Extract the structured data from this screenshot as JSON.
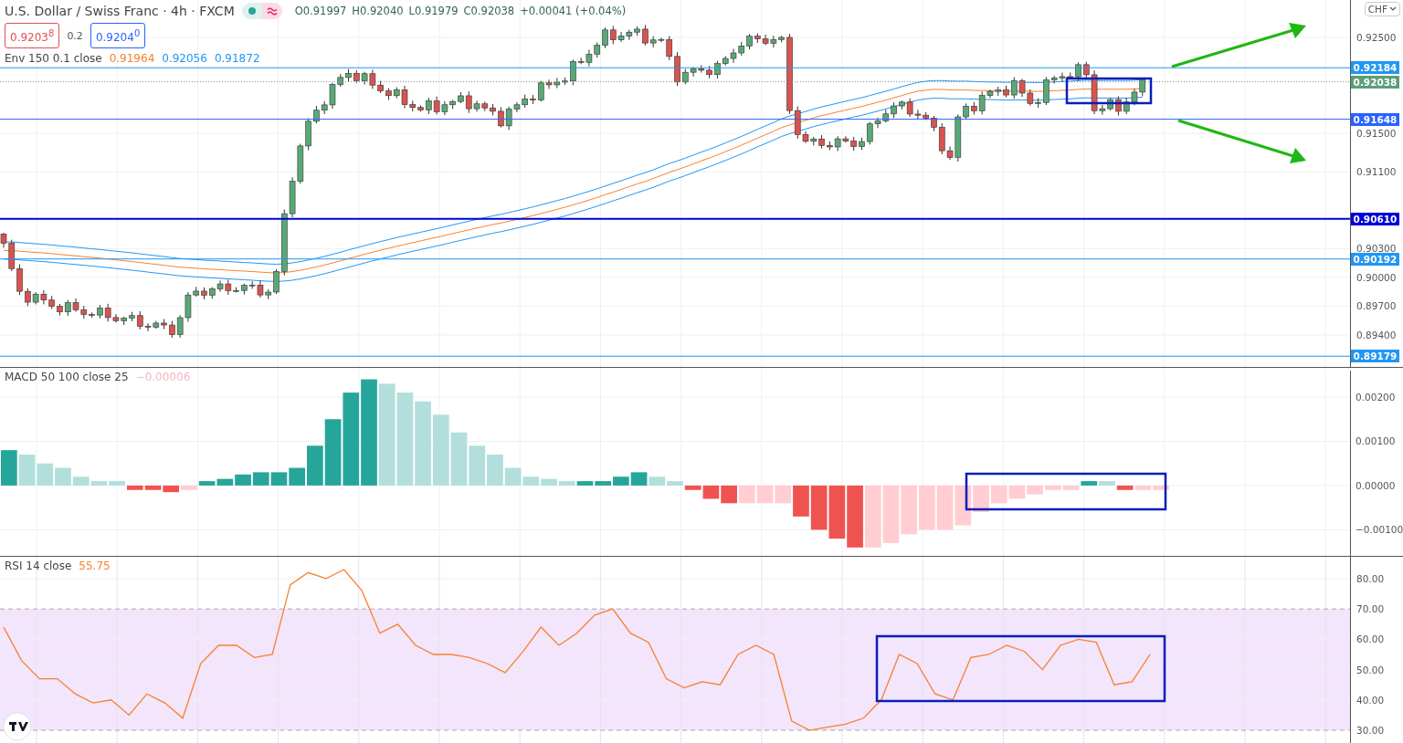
{
  "symbol": {
    "title": "U.S. Dollar / Swiss Franc · 4h · FXCM",
    "ohlc": [
      {
        "label": "O",
        "value": "0.91997"
      },
      {
        "label": "H",
        "value": "0.92040"
      },
      {
        "label": "L",
        "value": "0.91979"
      },
      {
        "label": "C",
        "value": "0.92038"
      }
    ],
    "change": "+0.00041 (+0.04%)"
  },
  "quote": {
    "bid": "0.9203$^{8}$",
    "spread": "0.2",
    "ask": "0.9204$^{0}$"
  },
  "envelope": {
    "label": "Env 150 0.1 close",
    "values": [
      {
        "text": "0.91964",
        "color": "#f7812f"
      },
      {
        "text": "0.92056",
        "color": "#2196f3"
      },
      {
        "text": "0.91872",
        "color": "#2196f3"
      }
    ]
  },
  "currency": "CHF",
  "price_axis": {
    "ticks": [
      "0.92500",
      "0.91500",
      "0.91100",
      "0.90300",
      "0.90000",
      "0.89700",
      "0.89400"
    ]
  },
  "price_lines": [
    {
      "label": "0.92184",
      "color": "#2196f3",
      "kind": "level"
    },
    {
      "label": "0.92038",
      "color": "#5d9e7a",
      "kind": "current"
    },
    {
      "label": "0.91648",
      "color": "#2962ff",
      "kind": "level"
    },
    {
      "label": "0.90610",
      "color": "#0000d8",
      "kind": "key"
    },
    {
      "label": "0.90192",
      "color": "#2196f3",
      "kind": "level"
    },
    {
      "label": "0.89179",
      "color": "#2196f3",
      "kind": "level"
    }
  ],
  "macd": {
    "label": "MACD 50 100 close 25",
    "value": "−0.00006",
    "chart_data": {
      "type": "bar",
      "ylim": [
        -0.00159,
        0.00266
      ],
      "yticks": [
        {
          "value": 0.002,
          "label": "0.00200"
        },
        {
          "value": 0.001,
          "label": "0.00100"
        },
        {
          "value": 0,
          "label": "0.00000"
        },
        {
          "value": -0.001,
          "label": "−0.00100"
        }
      ],
      "grid": true,
      "series": [
        {
          "color": "#26a69a",
          "values": [
            0.0008,
            null,
            null,
            null,
            null,
            null,
            null,
            null,
            null,
            null,
            null,
            0.0001,
            0.00015,
            0.00025,
            0.0003,
            0.0003,
            0.0004,
            0.0009,
            0.0015,
            0.0021,
            0.0024,
            null,
            null,
            null,
            null,
            null,
            null,
            null,
            null,
            null,
            null,
            null,
            0.0001,
            0.0001,
            0.0002,
            0.0003,
            null,
            null,
            null,
            null,
            null,
            null,
            null,
            null,
            null,
            null,
            null,
            null,
            null,
            null,
            null,
            null,
            null,
            null,
            null,
            null,
            null,
            null,
            null,
            null,
            0.0001,
            null,
            null,
            null,
            null,
            null,
            null,
            null,
            null,
            null,
            null,
            null,
            null,
            null,
            null
          ]
        },
        {
          "color": "#b2dfdb",
          "values": [
            null,
            0.0007,
            0.0005,
            0.0004,
            0.0002,
            0.0001,
            0.0001,
            null,
            null,
            null,
            null,
            null,
            null,
            null,
            null,
            null,
            null,
            null,
            null,
            null,
            null,
            0.0023,
            0.0021,
            0.0019,
            0.0016,
            0.0012,
            0.0009,
            0.0007,
            0.0004,
            0.0002,
            0.00015,
            0.0001,
            null,
            null,
            null,
            null,
            0.0002,
            0.0001,
            null,
            null,
            null,
            null,
            null,
            null,
            null,
            null,
            null,
            null,
            null,
            null,
            null,
            null,
            null,
            null,
            null,
            null,
            null,
            null,
            null,
            null,
            null,
            0.0001,
            null,
            null,
            null,
            null,
            null,
            null,
            null,
            null,
            null,
            null,
            null,
            null,
            null
          ]
        },
        {
          "color": "#ef5350",
          "values": [
            null,
            null,
            null,
            null,
            null,
            null,
            null,
            -0.0001,
            -0.0001,
            -0.00015,
            null,
            null,
            null,
            null,
            null,
            null,
            null,
            null,
            null,
            null,
            null,
            null,
            null,
            null,
            null,
            null,
            null,
            null,
            null,
            null,
            null,
            null,
            null,
            null,
            null,
            null,
            null,
            null,
            -0.0001,
            -0.0003,
            -0.0004,
            null,
            null,
            null,
            -0.0007,
            -0.001,
            -0.0012,
            -0.0014,
            null,
            null,
            null,
            null,
            null,
            null,
            null,
            null,
            null,
            null,
            null,
            null,
            null,
            null,
            -0.0001,
            null,
            null,
            null,
            null,
            null,
            null,
            null,
            null,
            null,
            null,
            null,
            null
          ]
        },
        {
          "color": "#ffcdd2",
          "values": [
            null,
            null,
            null,
            null,
            null,
            null,
            null,
            null,
            null,
            null,
            -0.0001,
            null,
            null,
            null,
            null,
            null,
            null,
            null,
            null,
            null,
            null,
            null,
            null,
            null,
            null,
            null,
            null,
            null,
            null,
            null,
            null,
            null,
            null,
            null,
            null,
            null,
            null,
            null,
            null,
            null,
            null,
            -0.0004,
            -0.0004,
            -0.0004,
            null,
            null,
            null,
            null,
            -0.0014,
            -0.0013,
            -0.0011,
            -0.001,
            -0.001,
            -0.0009,
            -0.0006,
            -0.0004,
            -0.0003,
            -0.0002,
            -0.0001,
            -0.0001,
            null,
            null,
            null,
            -0.0001,
            -0.0001,
            null,
            null,
            null,
            null,
            null,
            null,
            null,
            null,
            null,
            null
          ]
        }
      ]
    }
  },
  "rsi": {
    "label": "RSI 14 close",
    "value": "55.75",
    "chart_data": {
      "type": "line",
      "grid": true,
      "ylim": [
        25.2,
        87.2
      ],
      "yticks": [
        {
          "value": 80,
          "label": "80.00"
        },
        {
          "value": 70,
          "label": "70.00"
        },
        {
          "value": 60,
          "label": "60.00"
        },
        {
          "value": 50,
          "label": "50.00"
        },
        {
          "value": 40,
          "label": "40.00"
        },
        {
          "value": 30,
          "label": "30.00"
        }
      ],
      "series": [
        {
          "color": "#f7812f",
          "values": [
            64,
            53,
            47,
            47,
            42,
            39,
            40,
            35,
            42,
            39,
            34,
            52,
            58,
            58,
            54,
            55,
            78,
            82,
            80,
            83,
            76,
            62,
            65,
            58,
            55,
            55,
            54,
            52,
            49,
            56,
            64,
            58,
            62,
            68,
            70,
            62,
            59,
            47,
            44,
            46,
            45,
            55,
            58,
            55,
            33,
            30,
            31,
            32,
            34,
            40,
            55,
            52,
            42,
            40,
            54,
            55,
            58,
            56,
            50,
            58,
            60,
            59,
            45,
            46,
            55
          ]
        }
      ]
    }
  }
}
